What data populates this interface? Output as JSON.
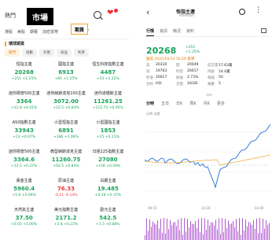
{
  "left": {
    "heading_hint": "熱門",
    "title": "市場",
    "tabs": [
      "港股",
      "美股",
      "期權",
      "加密貨幣",
      "期貨",
      "ETF"
    ],
    "active_tab": "期貨",
    "section_title": "環球期貨",
    "chips": [
      {
        "label": "熱門",
        "active": true
      },
      {
        "label": "指數",
        "active": false
      },
      {
        "label": "外匯",
        "active": false
      },
      {
        "label": "商品",
        "active": false
      },
      {
        "label": "利率",
        "active": false
      }
    ],
    "cells": [
      {
        "name": "恒指主連",
        "price": "20268",
        "chg": "+251 +1.25%",
        "dir": "up"
      },
      {
        "name": "國指主連",
        "price": "6913",
        "chg": "+85 +1.25%",
        "dir": "up"
      },
      {
        "name": "恒生科技指數主連",
        "price": "4487",
        "chg": "+53 +1.22%",
        "dir": "up"
      },
      {
        "name": "迷你標普500主連",
        "price": "3364",
        "chg": "+12.8 +0.41%",
        "dir": "up"
      },
      {
        "name": "迷你納斯達克100主連",
        "price": "3072.00",
        "chg": "+22.5 +0.83%",
        "dir": "up"
      },
      {
        "name": "迷你道瓊斯主連",
        "price": "11261.25",
        "chg": "+112.75 +0.95%",
        "dir": "up"
      },
      {
        "name": "A50指數主連",
        "price": "33943",
        "chg": "+23 +0.07%",
        "dir": "up"
      },
      {
        "name": "小型恒指主連",
        "price": "6891",
        "chg": "+186 +1.08%",
        "dir": "up"
      },
      {
        "name": "小型國指主連",
        "price": "1853",
        "chg": "+25 +0.11%",
        "dir": "up"
      },
      {
        "name": "迷你標普500主連",
        "price": "3364.6",
        "chg": "+12.5 +0.37%",
        "dir": "up"
      },
      {
        "name": "微型納斯達克主連",
        "price": "11260.75",
        "chg": "+92.5 +0.83%",
        "dir": "up"
      },
      {
        "name": "日經225指數主連",
        "price": "27080",
        "chg": "+158 +0.59%",
        "dir": "up"
      },
      {
        "name": "黃金主連",
        "price": "5960.4",
        "chg": "+5.6 +0.09%",
        "dir": "up"
      },
      {
        "name": "原油主連",
        "price": "76.33",
        "chg": "-0.11 -0.14%",
        "dir": "down"
      },
      {
        "name": "白銀主連",
        "price": "19.485",
        "chg": "+0.29 +0.37%",
        "dir": "up"
      },
      {
        "name": "天然氣主連",
        "price": "37.50",
        "chg": "+0.05 +1.00%",
        "dir": "up"
      },
      {
        "name": "美元指數主連",
        "price": "2171.2",
        "chg": "+2.8 +0.23%",
        "dir": "up"
      },
      {
        "name": "歐元主連",
        "price": "542.5",
        "chg": "+1.5 +0.88%",
        "dir": "up"
      }
    ]
  },
  "right": {
    "name": "恒指主連",
    "sub": "HSImain",
    "tabs": [
      "行情",
      "資訊",
      "簡況",
      "資料"
    ],
    "active_tab": "行情",
    "price": "20268",
    "chg_abs": "+251",
    "chg_pct": "+1.25%",
    "time": "盤前 2022/10/14 16:29 香港",
    "stats": [
      {
        "k": "高",
        "v": "20310",
        "k2": "開",
        "v2": "20049",
        "k3": "成交量",
        "v3": "17.63萬"
      },
      {
        "k": "低",
        "v": "19763",
        "k2": "昨結",
        "v2": "20017",
        "k3": "持倉",
        "v3": "14.4萬"
      },
      {
        "k": "昨收",
        "v": "20017",
        "k2": "振幅",
        "v2": "2.73%",
        "k3": "每點",
        "v3": "50"
      },
      {
        "k": "合約",
        "v": "HSI",
        "k2": "交割",
        "v2": "10/28",
        "k3": "乘數",
        "v3": "5"
      }
    ],
    "tools": [
      "分時",
      "五日",
      "日K",
      "周K",
      "月K",
      "更多"
    ],
    "active_tool": "分時",
    "chart_meta": "分時 均價",
    "x_labels": [
      "09:15",
      "14:30",
      "03:00"
    ]
  },
  "colors": {
    "up": "#1aa35a",
    "down": "#e33333",
    "accent": "#f5a623",
    "line": "#1e6fd9",
    "avg": "#f0a830",
    "vol": "#b05ad0"
  }
}
